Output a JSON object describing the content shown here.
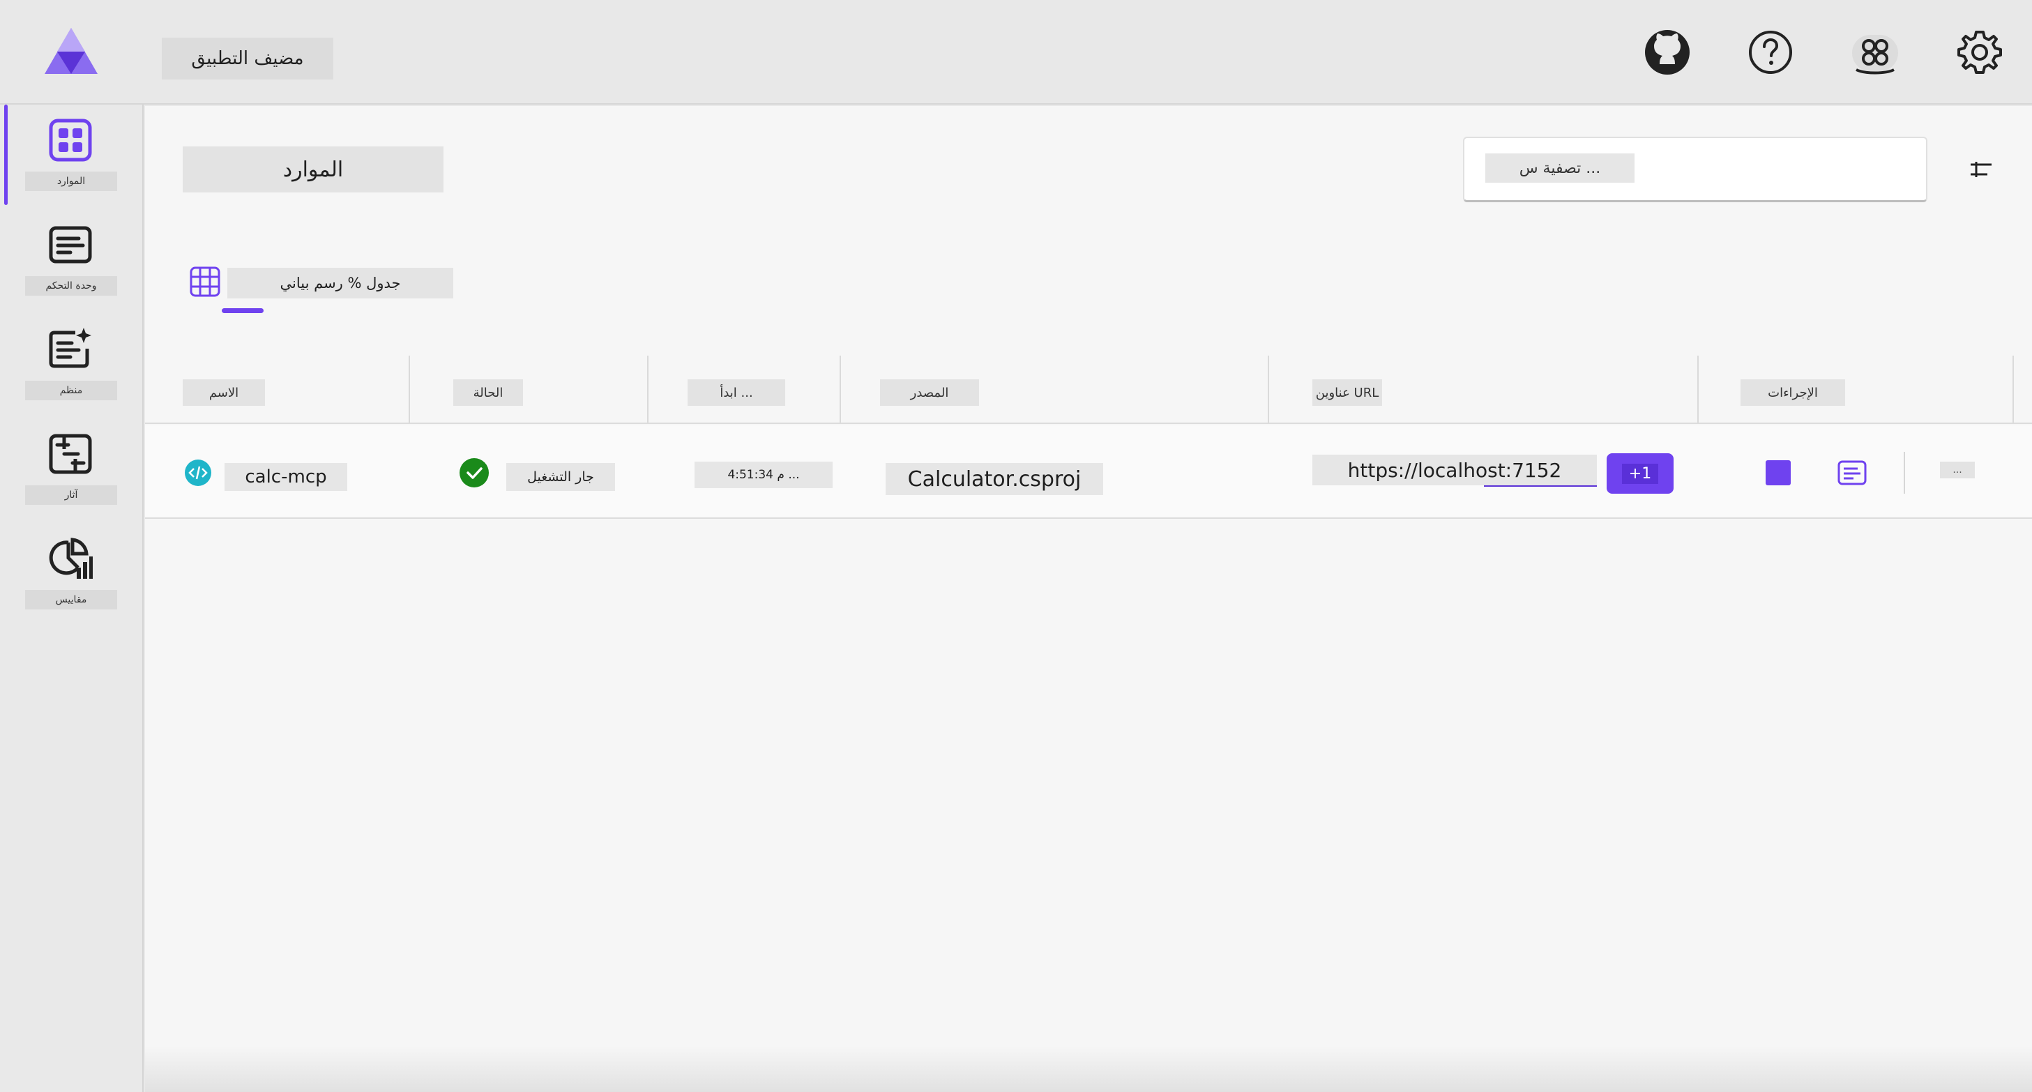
{
  "header": {
    "app_host_label": "مضيف التطبيق",
    "icons": [
      "logo-icon",
      "github-icon",
      "help-icon",
      "dev-icon",
      "gear-icon"
    ]
  },
  "sidebar": {
    "items": [
      {
        "label": "الموارد",
        "icon": "resources-icon",
        "active": true
      },
      {
        "label": "وحدة التحكم",
        "icon": "console-icon",
        "active": false
      },
      {
        "label": "منظم",
        "icon": "structured-icon",
        "active": false
      },
      {
        "label": "آثار",
        "icon": "traces-icon",
        "active": false
      },
      {
        "label": "مقاييس",
        "icon": "metrics-icon",
        "active": false
      }
    ]
  },
  "main": {
    "title": "الموارد",
    "filter_placeholder": "تصفية س ...",
    "view_label": "جدول % رسم بياني"
  },
  "table": {
    "headers": {
      "name": "الاسم",
      "state": "الحالة",
      "start": "ابدأ ...",
      "source": "المصدر",
      "urls": "عناوين URL",
      "actions": "الإجراءات"
    },
    "rows": [
      {
        "name": "calc-mcp",
        "state": "جار التشغيل",
        "start_time": "4:51:34 م ...",
        "source": "Calculator.csproj",
        "url": "https://localhost:7152",
        "extra_urls": "+1",
        "more": "..."
      }
    ]
  },
  "colors": {
    "accent": "#6f42ef",
    "running_green": "#1a8a1a",
    "project_teal": "#1fb5c9"
  }
}
